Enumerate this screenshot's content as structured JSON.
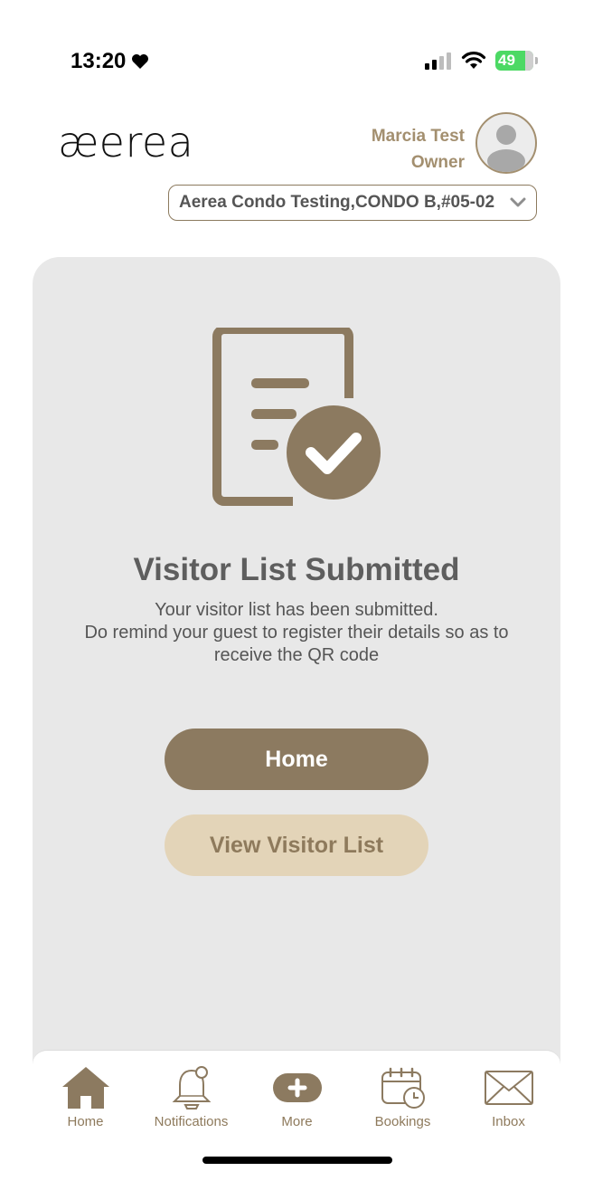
{
  "status_bar": {
    "time": "13:20",
    "battery": "49"
  },
  "header": {
    "logo": "æerea",
    "user_name": "Marcia Test",
    "user_role": "Owner",
    "unit": "Aerea Condo Testing,CONDO B,#05-02"
  },
  "card": {
    "title": "Visitor List Submitted",
    "message_line1": "Your visitor list has been submitted.",
    "message_line2": "Do remind your guest to register their details so as to",
    "message_line3": "receive the QR code",
    "home_button": "Home",
    "view_button": "View Visitor List"
  },
  "nav": {
    "items": [
      {
        "label": "Home",
        "icon": "home-icon"
      },
      {
        "label": "Notifications",
        "icon": "bell-icon"
      },
      {
        "label": "More",
        "icon": "plus-icon"
      },
      {
        "label": "Bookings",
        "icon": "calendar-icon"
      },
      {
        "label": "Inbox",
        "icon": "mail-icon"
      }
    ]
  },
  "colors": {
    "accent": "#8c7a60",
    "accent_light": "#e3d4b8",
    "card_bg": "#e8e8e8"
  }
}
